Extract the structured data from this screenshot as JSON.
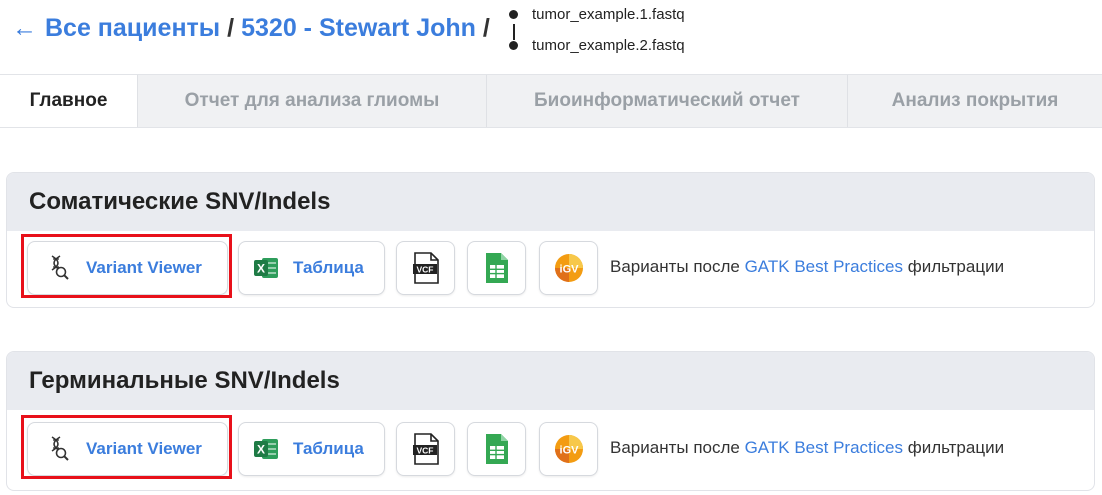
{
  "breadcrumb": {
    "arrow": "←",
    "all_patients": "Все пациенты",
    "separator": "/",
    "patient": "5320 - Stewart John",
    "files": [
      "tumor_example.1.fastq",
      "tumor_example.2.fastq"
    ]
  },
  "tabs": [
    {
      "label": "Главное",
      "active": true
    },
    {
      "label": "Отчет для анализа глиомы",
      "active": false
    },
    {
      "label": "Биоинформатический отчет",
      "active": false
    },
    {
      "label": "Анализ покрытия",
      "active": false
    }
  ],
  "sections": [
    {
      "title": "Соматические SNV/Indels",
      "variant_viewer_label": "Variant Viewer",
      "table_label": "Таблица",
      "description": {
        "before": "Варианты после ",
        "link": "GATK Best Practices",
        "after": " фильтрации"
      }
    },
    {
      "title": "Герминальные SNV/Indels",
      "variant_viewer_label": "Variant Viewer",
      "table_label": "Таблица",
      "description": {
        "before": "Варианты после ",
        "link": "GATK Best Practices",
        "after": " фильтрации"
      }
    }
  ],
  "icons": {
    "variant": "dna-magnifier-icon",
    "table": "excel-icon",
    "vcf": "vcf-file-icon",
    "sheet": "spreadsheet-icon",
    "igv": "igv-icon",
    "vcf_text": "VCF",
    "igv_text": "iGV",
    "excel_letter": "X"
  },
  "colors": {
    "link": "#3b7ddd",
    "highlight": "#e8101a",
    "excel_green": "#1e7b45",
    "sheet_green": "#34a853",
    "igv_orange": "#f39c12"
  }
}
